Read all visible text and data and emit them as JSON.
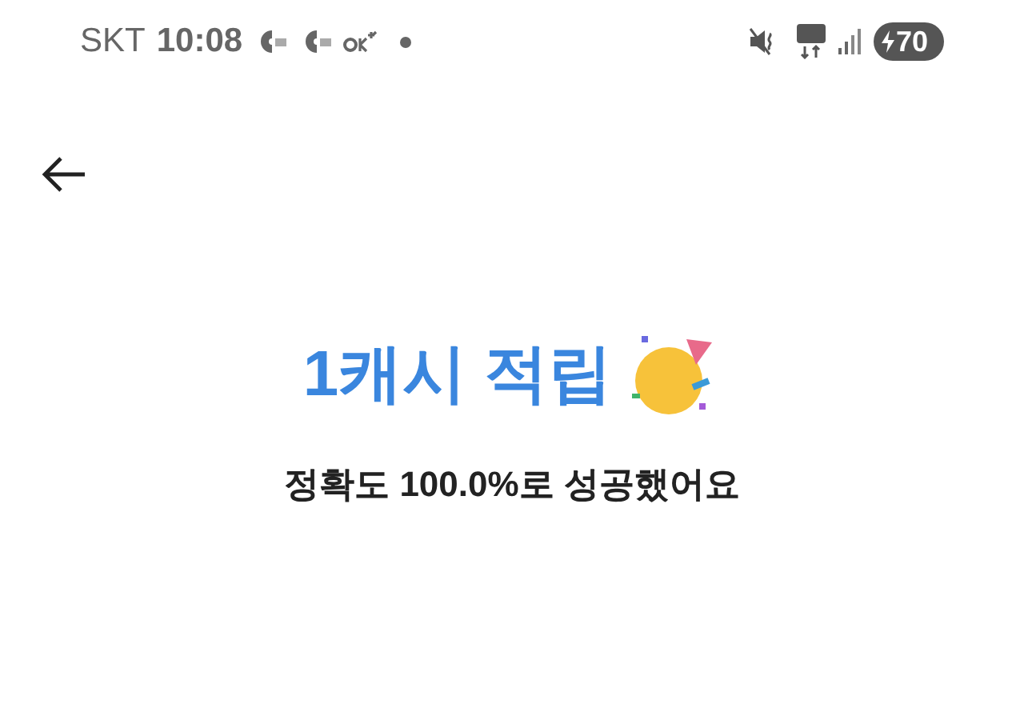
{
  "status_bar": {
    "carrier": "SKT",
    "time": "10:08",
    "battery": "70"
  },
  "title": "1캐시 적립",
  "subtitle": "정확도 100.0%로 성공했어요"
}
